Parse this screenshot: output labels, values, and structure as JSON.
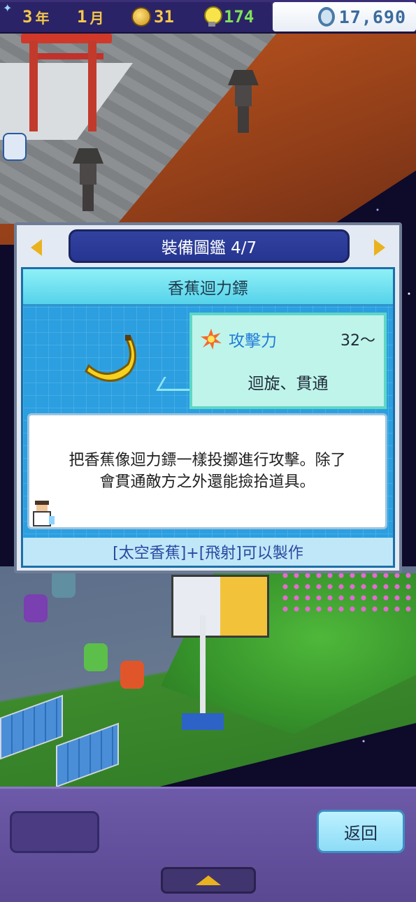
{
  "hud": {
    "year": "3",
    "year_unit": "年",
    "month": "1",
    "month_unit": "月",
    "gold_medals": "31",
    "idea_points": "174",
    "money": "17,690",
    "icons": [
      "star-icon",
      "coin-icon",
      "bulb-icon",
      "money-coin-icon"
    ]
  },
  "panel": {
    "title": "裝備圖鑑 4/7",
    "item_name": "香蕉迴力鏢",
    "stat_label": "攻擊力",
    "stat_value": "32～",
    "traits": "迴旋、貫通",
    "description_line1": "把香蕉像迴力鏢一樣投擲進行攻擊。除了",
    "description_line2": "會貫通敵方之外還能撿拾道具。",
    "recipe": "[太空香蕉]+[飛射]可以製作",
    "icons": [
      "left-arrow-icon",
      "right-arrow-icon",
      "banana-icon",
      "burst-icon"
    ]
  },
  "bottom": {
    "back_label": "返回",
    "icons": [
      "expand-up-icon"
    ]
  },
  "colors": {
    "hud_bg": "#2b2367",
    "accent_gold": "#f5c84a",
    "idea_green": "#7ee25a",
    "money_blue": "#3b6c9e",
    "panel_header": "#263591",
    "stat_blue": "#1f7ad9",
    "bottom_bar": "#6d5aa8"
  }
}
